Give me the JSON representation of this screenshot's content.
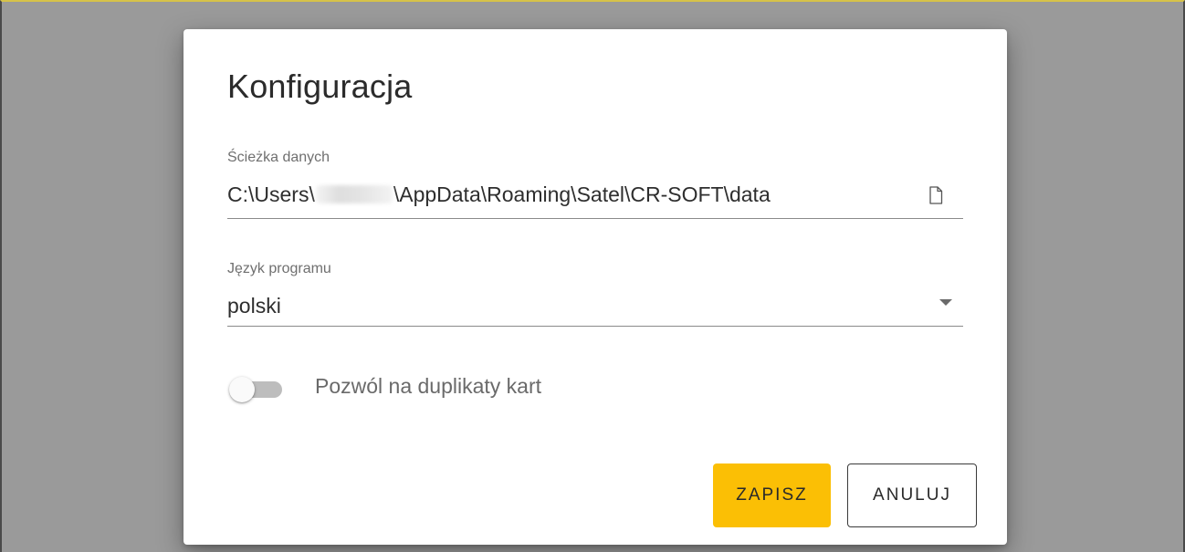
{
  "dialog": {
    "title": "Konfiguracja"
  },
  "path_field": {
    "label": "Ścieżka danych",
    "value_prefix": "C:\\Users\\",
    "value_suffix": "\\AppData\\Roaming\\Satel\\CR-SOFT\\data",
    "icon": "file-icon"
  },
  "language_field": {
    "label": "Język programu",
    "value": "polski",
    "icon": "dropdown-arrow-icon"
  },
  "duplicates_toggle": {
    "label": "Pozwól na duplikaty kart",
    "checked": false
  },
  "buttons": {
    "save_label": "ZAPISZ",
    "cancel_label": "ANULUJ"
  },
  "colors": {
    "accent": "#fbbf05",
    "overlay": "#9a9a9a"
  }
}
